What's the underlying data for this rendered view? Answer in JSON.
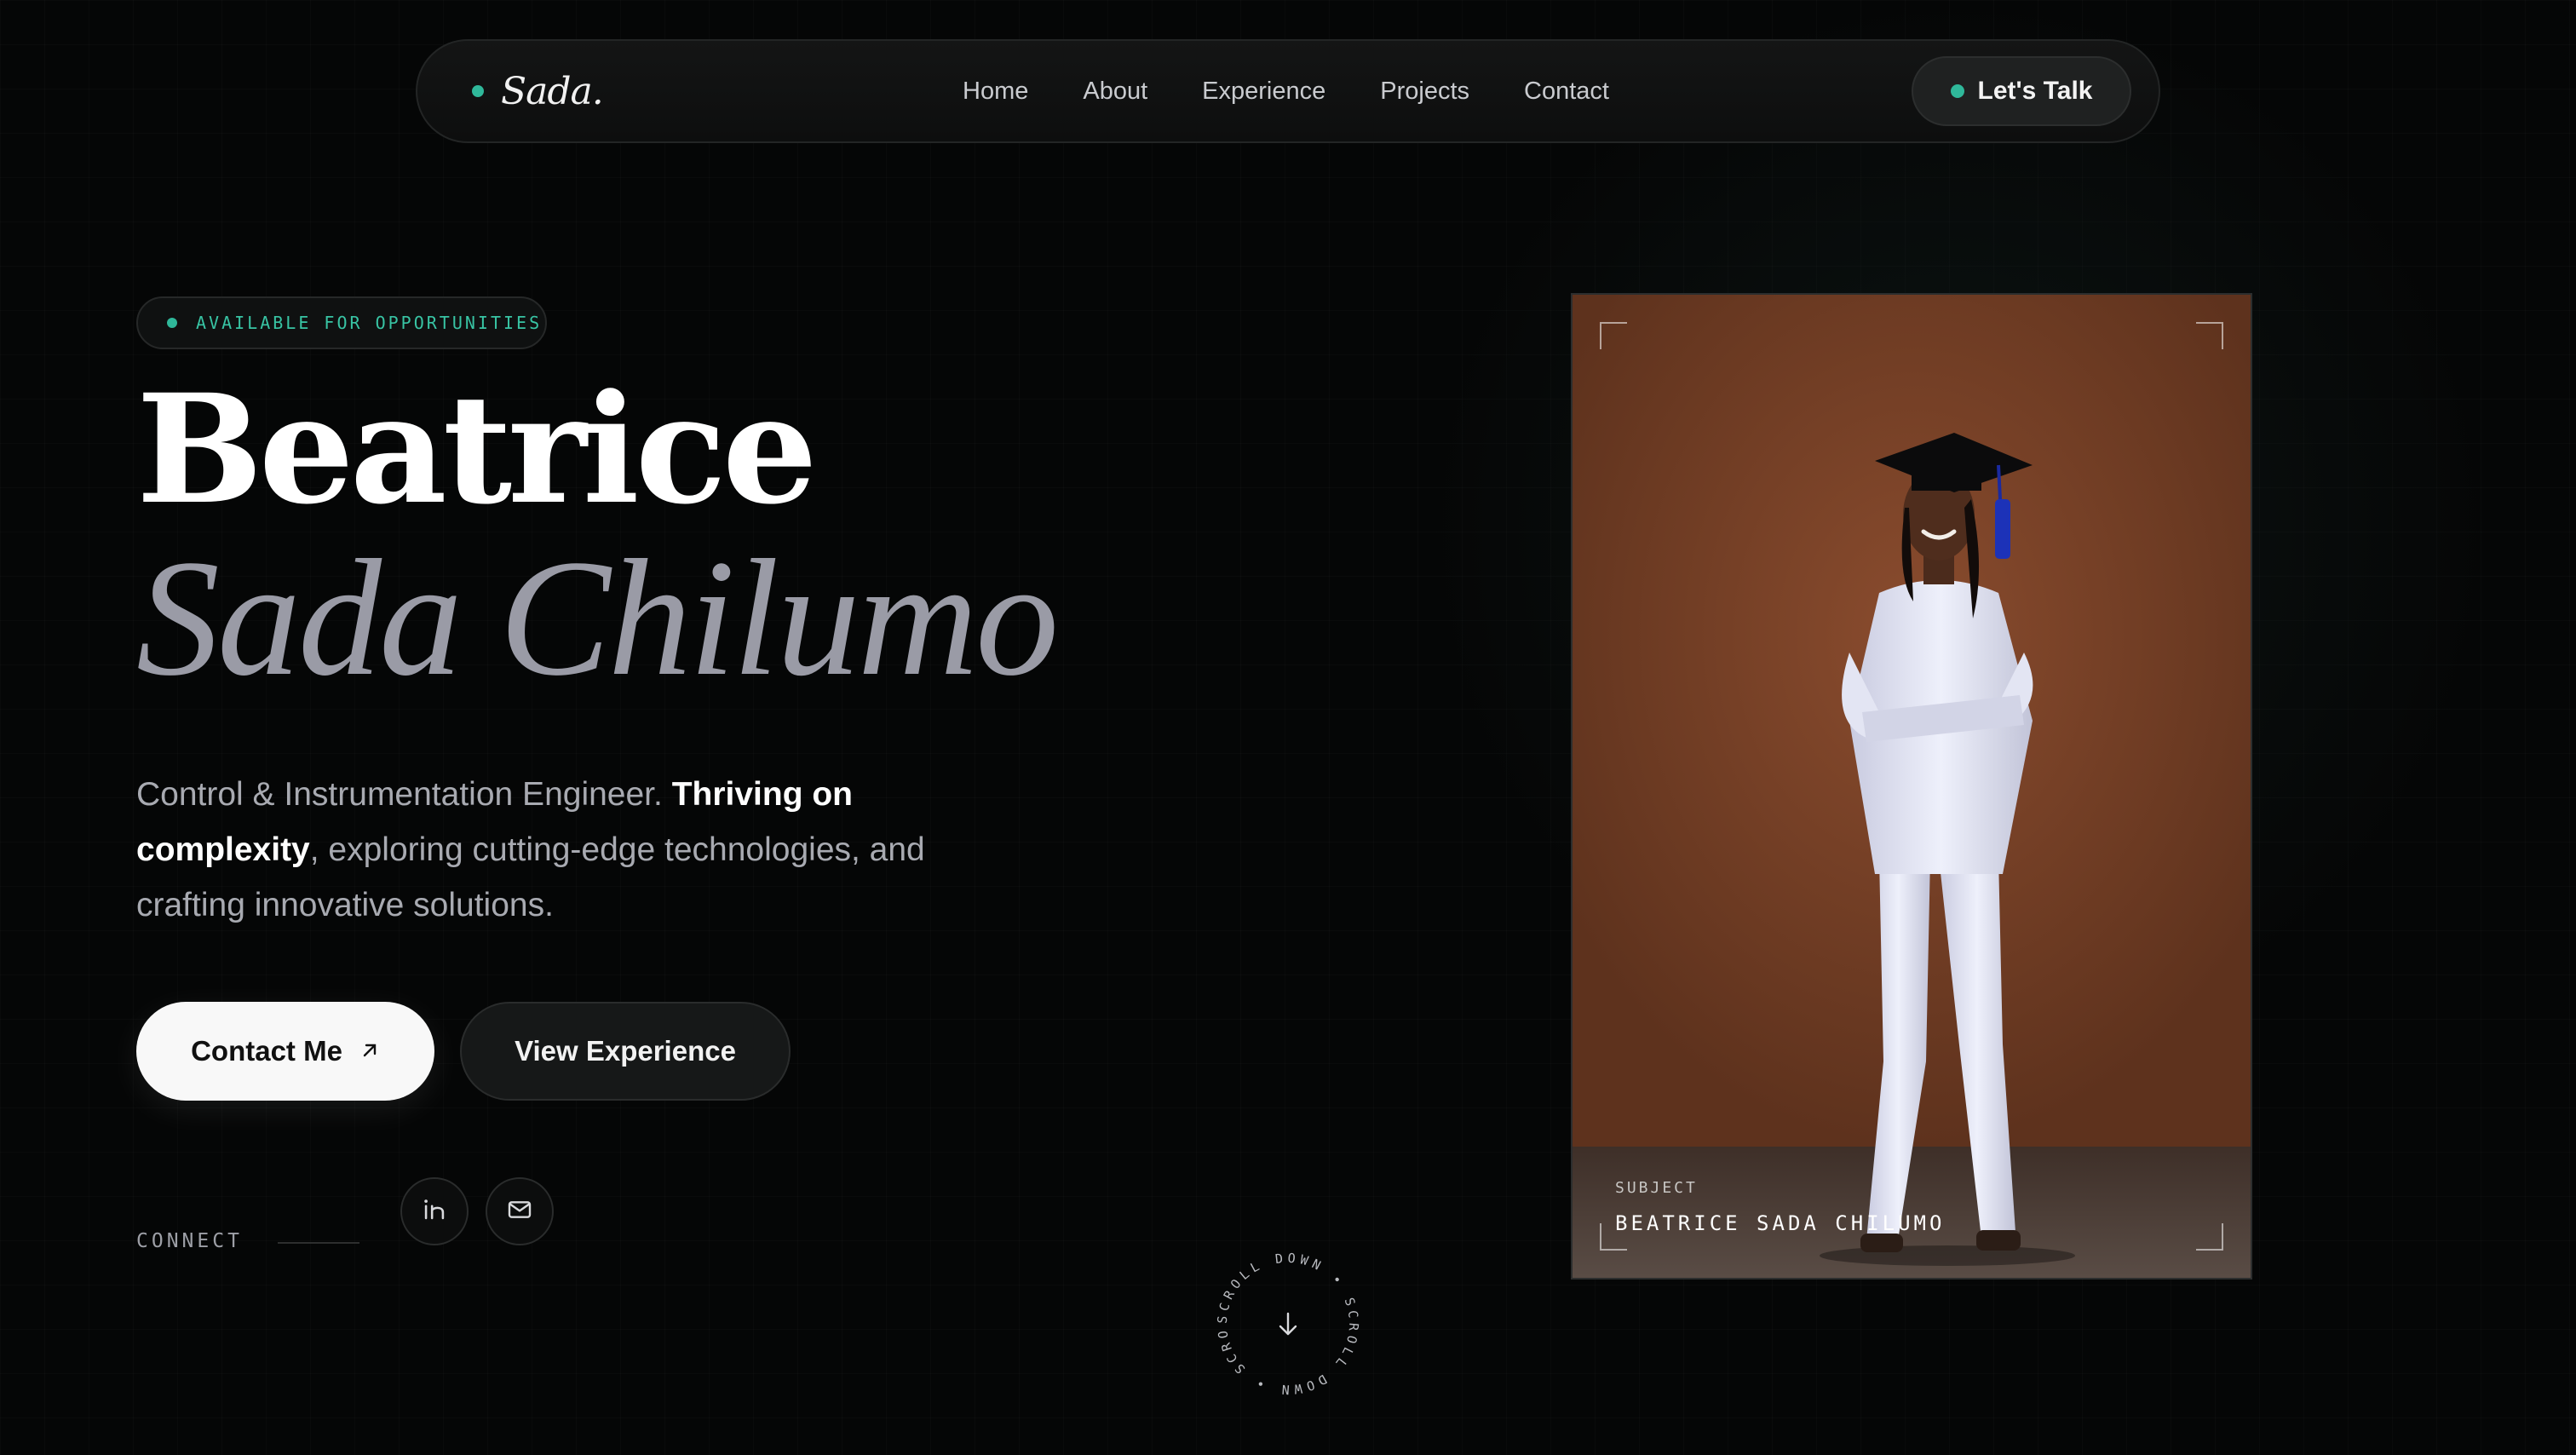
{
  "nav": {
    "brand": "Sada.",
    "links": [
      "Home",
      "About",
      "Experience",
      "Projects",
      "Contact"
    ],
    "cta": "Let's Talk"
  },
  "hero": {
    "badge": "AVAILABLE FOR OPPORTUNITIES",
    "first_name": "Beatrice",
    "last_name": "Sada Chilumo",
    "tagline_part1": "Control & Instrumentation Engineer. ",
    "tagline_bold": "Thriving on complexity",
    "tagline_part2": ", exploring cutting-edge technologies, and crafting innovative solutions.",
    "primary_button": "Contact Me",
    "secondary_button": "View Experience",
    "connect_label": "CONNECT"
  },
  "social": {
    "linkedin_icon": "linkedin-icon",
    "email_icon": "mail-icon"
  },
  "scroll": {
    "ring_text": "SCROLL DOWN • SCROLL DOWN • SCRO"
  },
  "photo": {
    "label": "SUBJECT",
    "name": "BEATRICE SADA CHILUMO"
  },
  "colors": {
    "accent": "#2fb89a",
    "background": "#050606",
    "photo_backdrop": "#7a4329"
  }
}
